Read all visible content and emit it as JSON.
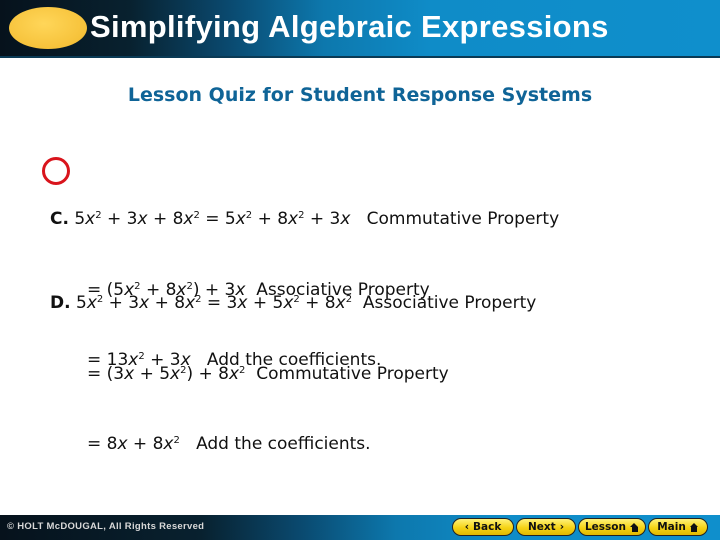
{
  "header": {
    "title": "Simplifying Algebraic Expressions"
  },
  "subtitle": "Lesson Quiz for Student Response Systems",
  "options": [
    {
      "label": "C.",
      "selected": true,
      "lines": [
        {
          "prefix": "",
          "expr": "5x² + 3x + 8x² = 5x² + 8x² + 3x",
          "reason": "Commutative Property"
        },
        {
          "prefix": "= ",
          "expr": "(5x² + 8x²) + 3x",
          "reason": "Associative Property"
        },
        {
          "prefix": "= ",
          "expr": "13x² + 3x",
          "reason": "Add the coefficients."
        }
      ]
    },
    {
      "label": "D.",
      "selected": false,
      "lines": [
        {
          "prefix": "",
          "expr": "5x² + 3x + 8x² = 3x + 5x² + 8x²",
          "reason": "Associative Property"
        },
        {
          "prefix": "= ",
          "expr": "(3x + 5x²) + 8x²",
          "reason": "Commutative Property"
        },
        {
          "prefix": "= ",
          "expr": "8x + 8x²",
          "reason": "Add the coefficients."
        }
      ]
    }
  ],
  "footer": {
    "copyright": "© HOLT McDOUGAL, All Rights Reserved",
    "buttons": {
      "back": "Back",
      "back_icon": "chevron-left-icon",
      "next": "Next",
      "next_icon": "chevron-right-icon",
      "lesson": "Lesson",
      "main": "Main",
      "home_icon": "home-icon"
    }
  },
  "colors": {
    "selection_circle": "#d9141c",
    "subtitle": "#0f6497",
    "button_fill": "#f5d315"
  }
}
